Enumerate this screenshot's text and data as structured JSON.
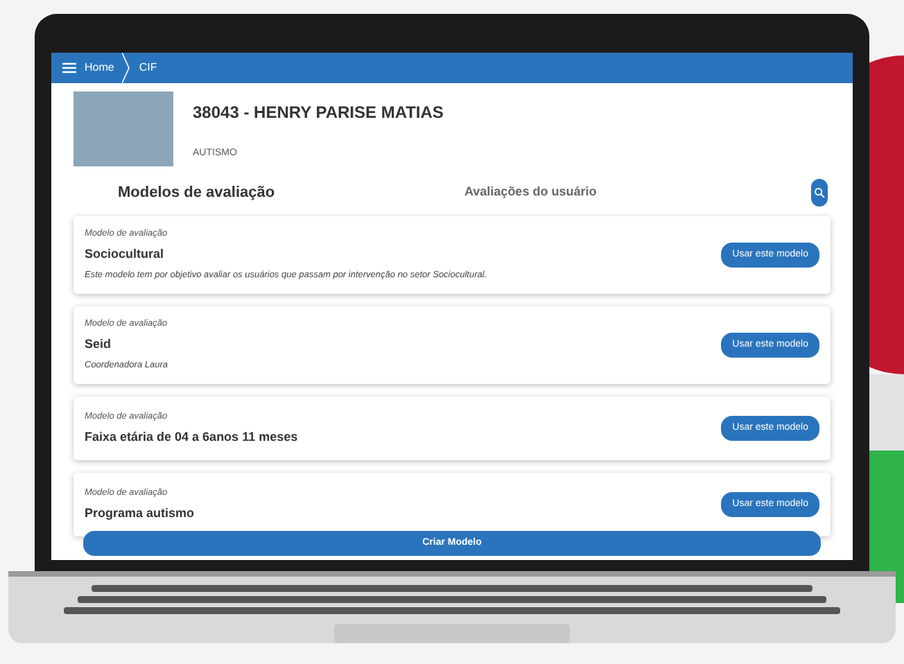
{
  "nav": {
    "breadcrumbs": [
      "Home",
      "CIF"
    ]
  },
  "patient": {
    "title": "38043 - HENRY PARISE MATIAS",
    "tag": "AUTISMO"
  },
  "tabs": [
    {
      "label": "Modelos de avaliação",
      "selected": true
    },
    {
      "label": "Avaliações do usuário",
      "selected": false
    }
  ],
  "models": [
    {
      "caption": "Modelo de avaliação",
      "name": "Sociocultural",
      "description": "Este modelo tem por objetivo avaliar os usuários que passam por intervenção no setor Sociocultural.",
      "button": "Usar este modelo"
    },
    {
      "caption": "Modelo de avaliação",
      "name": "Seid",
      "description": "Coordenadora Laura",
      "button": "Usar este modelo"
    },
    {
      "caption": "Modelo de avaliação",
      "name": "Faixa etária de 04 a 6anos 11 meses",
      "button": "Usar este modelo"
    },
    {
      "caption": "Modelo de avaliação",
      "name": "Programa autismo",
      "button": "Usar este modelo"
    }
  ],
  "create_button": "Criar Modelo"
}
